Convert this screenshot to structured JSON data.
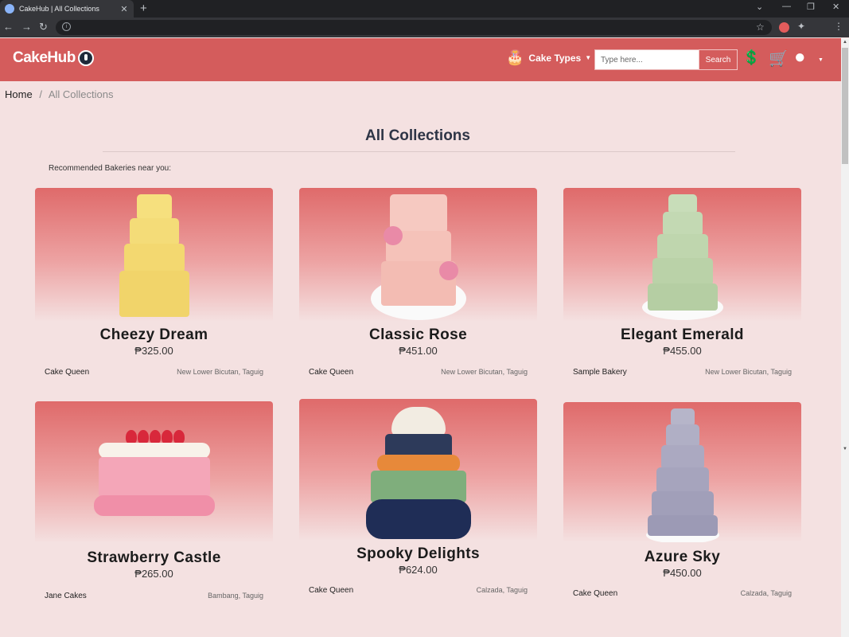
{
  "browser": {
    "tab_title": "CakeHub | All Collections",
    "tab_close": "✕",
    "new_tab": "+",
    "btn_back": "←",
    "btn_forward": "→",
    "btn_reload": "↻",
    "omni_info": "i",
    "btn_minimize": "—",
    "btn_maximize": "❐",
    "btn_close": "✕",
    "btn_dropdown": "⌄",
    "bookmark_icon": "☆",
    "extensions_icon": "✦",
    "menu_icon": "⋮"
  },
  "header": {
    "logo": "CakeHub",
    "cake_types_icon": "🎂",
    "cake_types": "Cake Types",
    "caret": "▼",
    "search_placeholder": "Type here...",
    "search_button": "Search",
    "donate_icon": "💲",
    "cart_icon": "🛒",
    "user_icon": "●",
    "user_caret": "▼"
  },
  "breadcrumb": {
    "home": "Home",
    "separator": "/",
    "current": "All Collections"
  },
  "page": {
    "title": "All Collections",
    "recommended_label": "Recommended Bakeries near you:"
  },
  "products": [
    {
      "name": "Cheezy Dream",
      "price": "₱325.00",
      "bakery": "Cake Queen",
      "location": "New Lower Bicutan, Taguig"
    },
    {
      "name": "Classic Rose",
      "price": "₱451.00",
      "bakery": "Cake Queen",
      "location": "New Lower Bicutan, Taguig"
    },
    {
      "name": "Elegant Emerald",
      "price": "₱455.00",
      "bakery": "Sample Bakery",
      "location": "New Lower Bicutan, Taguig"
    },
    {
      "name": "Strawberry Castle",
      "price": "₱265.00",
      "bakery": "Jane Cakes",
      "location": "Bambang, Taguig"
    },
    {
      "name": "Spooky Delights",
      "price": "₱624.00",
      "bakery": "Cake Queen",
      "location": "Calzada, Taguig"
    },
    {
      "name": "Azure Sky",
      "price": "₱450.00",
      "bakery": "Cake Queen",
      "location": "Calzada, Taguig"
    }
  ],
  "colors": {
    "brand": "#d45c5c",
    "page_bg": "#f4e1e1"
  }
}
